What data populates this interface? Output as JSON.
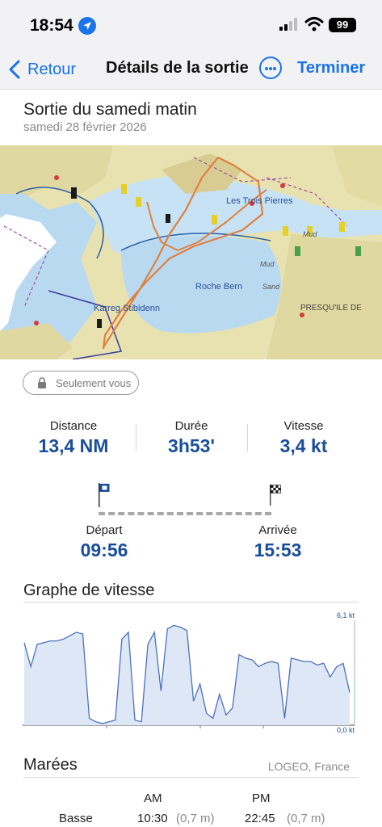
{
  "status": {
    "time": "18:54",
    "battery": "99"
  },
  "nav": {
    "back_label": "Retour",
    "title": "Détails de la sortie",
    "done_label": "Terminer"
  },
  "trip": {
    "title": "Sortie du samedi matin",
    "date": "samedi 28 février 2026"
  },
  "map": {
    "labels": [
      "Les Trois Pierres",
      "Mud",
      "Roche Bern",
      "Sand",
      "Karreg Stibidenn",
      "PRESQU'ILE DE"
    ]
  },
  "privacy": {
    "label": "Seulement vous"
  },
  "stats": [
    {
      "label": "Distance",
      "value": "13,4 NM"
    },
    {
      "label": "Durée",
      "value": "3h53'"
    },
    {
      "label": "Vitesse",
      "value": "3,4 kt"
    }
  ],
  "timeline": {
    "start": {
      "label": "Départ",
      "value": "09:56"
    },
    "end": {
      "label": "Arrivée",
      "value": "15:53"
    }
  },
  "speed_graph": {
    "title": "Graphe de vitesse"
  },
  "chart_data": {
    "type": "area",
    "title": "Graphe de vitesse",
    "y_unit": "kt",
    "ylim": [
      0,
      6.1
    ],
    "y_tick_labels": [
      "6,1 kt",
      "0,0 kt"
    ],
    "grid": false,
    "series": [
      {
        "color": "#4a72c0",
        "values": [
          4.8,
          3.4,
          4.7,
          4.8,
          4.9,
          4.9,
          5.0,
          5.2,
          5.4,
          5.3,
          0.4,
          0.2,
          0.1,
          0.2,
          0.3,
          5.0,
          5.4,
          0.3,
          0.2,
          4.7,
          5.4,
          2.0,
          5.6,
          5.8,
          5.7,
          5.5,
          1.4,
          2.4,
          0.7,
          0.4,
          1.8,
          0.6,
          1.0,
          4.1,
          3.9,
          3.8,
          3.4,
          3.6,
          3.7,
          3.6,
          0.4,
          3.9,
          3.8,
          3.7,
          3.7,
          3.5,
          3.6,
          2.8,
          3.4,
          3.6,
          1.9
        ]
      }
    ]
  },
  "tides": {
    "title": "Marées",
    "location": "LOGEO, France",
    "columns": [
      "AM",
      "PM"
    ],
    "rows": [
      {
        "label": "Basse",
        "am_time": "10:30",
        "am_height": "(0,7 m)",
        "pm_time": "22:45",
        "pm_height": "(0,7 m)"
      }
    ]
  }
}
